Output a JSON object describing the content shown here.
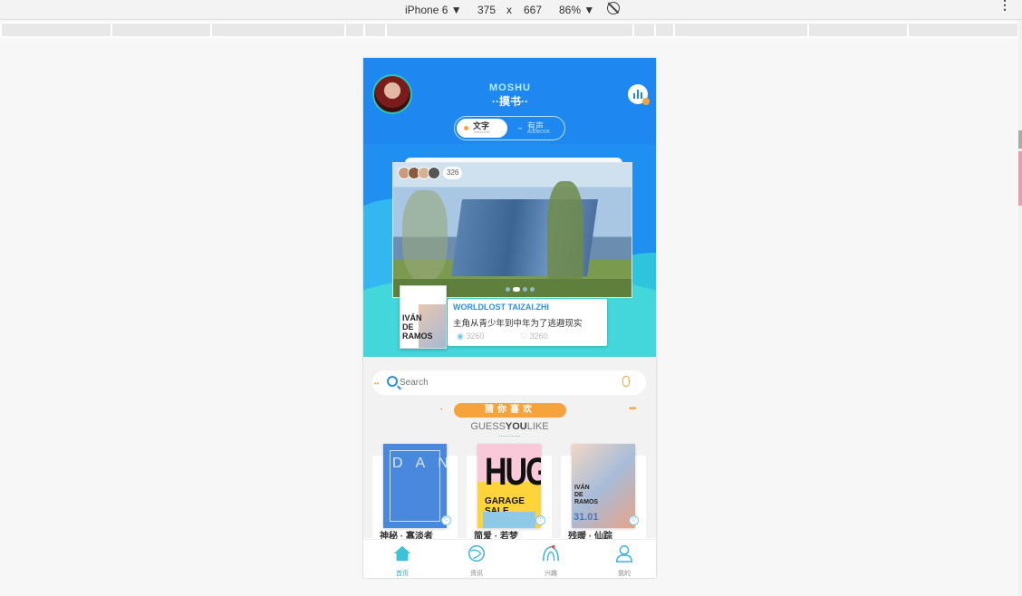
{
  "devtools": {
    "device": "iPhone 6 ▼",
    "width": "375",
    "times": "x",
    "height": "667",
    "zoom": "86% ▼",
    "more": "⋮"
  },
  "app": {
    "brand_en": "MOSHU",
    "brand_cn": "··摸书··",
    "toggle": {
      "text_label": "文字",
      "text_sub": "ENGLISH",
      "audio_label": "有声",
      "audio_sub": "AUDBOOK"
    }
  },
  "banner": {
    "reader_count": "326",
    "card_title": "WORLDLOST TAIZAI.ZHI",
    "card_subtitle": "主角从青少年到中年为了逃避现实",
    "views": "3260",
    "likes": "3260",
    "mini_cover_text": "IVÁN\nDE\nRAMOS",
    "slide_count": 4,
    "active_slide": 1
  },
  "search": {
    "placeholder": "Search"
  },
  "recommend": {
    "title_cn": "猜你喜欢",
    "title_en_1": "GUESS",
    "title_en_2": "YOU",
    "title_en_3": "LIKE"
  },
  "books": [
    {
      "title": "神秘 · 寡淡者",
      "cover_text": "DANCE",
      "heart": "♡"
    },
    {
      "title": "简爱 · 若梦",
      "cover_text": "HUGE",
      "cover_sub": "GARAGE SALE",
      "heart": "♡"
    },
    {
      "title": "残暖 · 仙踪",
      "cover_text": "IVÁN\nDE\nRAMOS",
      "cover_num": "31.01",
      "heart": "♡"
    }
  ],
  "tabs": [
    {
      "label": "首页",
      "active": true
    },
    {
      "label": "资讯",
      "active": false
    },
    {
      "label": "兴趣",
      "active": false
    },
    {
      "label": "我的",
      "active": false
    }
  ],
  "colors": {
    "primary": "#1e88f0",
    "accent": "#f6a33c",
    "teal": "#43d6da"
  }
}
